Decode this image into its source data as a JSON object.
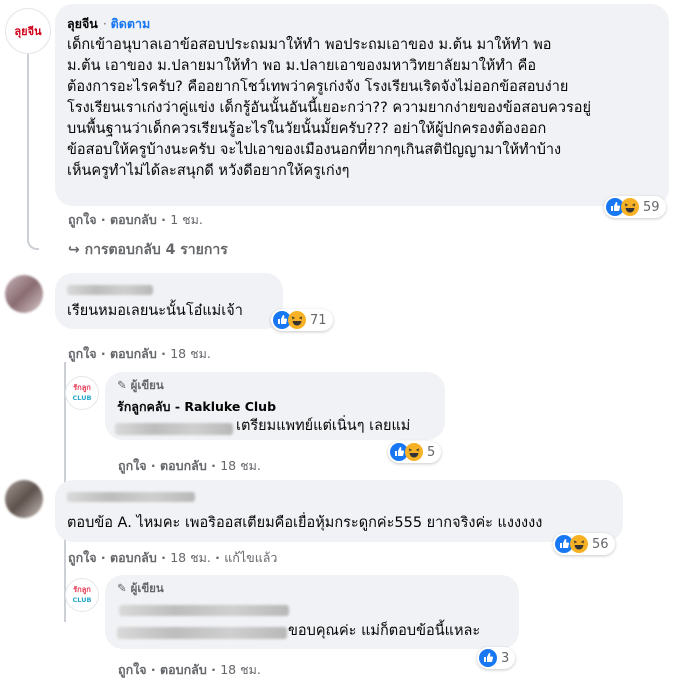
{
  "post_comment": {
    "author": "ลุยจีน",
    "follow_label": "ติดตาม",
    "text": "เด็กเข้าอนุบาลเอาข้อสอบประถมมาให้ทำ พอประถมเอาของ ม.ต้น มาให้ทำ พอ\nม.ต้น เอาของ ม.ปลายมาให้ทำ พอ ม.ปลายเอาของมหาวิทยาลัยมาให้ทำ คือ\nต้องการอะไรครับ? คืออยากโชว์เทพว่าครูเก่งจัง โรงเรียนเริดจังไม่ออกข้อสอบง่าย\nโรงเรียนเราเก่งว่าคู่แข่ง เด็กรู้อันนั้นอันนี้เยอะกว่า?? ความยากง่ายของข้อสอบควรอยู่\nบนพื้นฐานว่าเด็กควรเรียนรู้อะไรในวัยนั้นมั้ยครับ??? อย่าให้ผู้ปกครองต้องออก\nข้อสอบให้ครูบ้างนะครับ จะไปเอาของเมืองนอกที่ยากๆเกินสติปัญญามาให้ทำบ้าง\nเห็นครูทำไม่ได้ละสนุกดี หวังดีอยากให้ครูเก่งๆ",
    "like_label": "ถูกใจ",
    "reply_label": "ตอบกลับ",
    "time": "1 ชม.",
    "reactions_count": "59",
    "replies_link": "การตอบกลับ 4 รายการ",
    "avatar_text": "ลุยจีน"
  },
  "comment2": {
    "text": "เรียนหมอเลยนะนั้นโอ๋แม่เจ้า",
    "like_label": "ถูกใจ",
    "reply_label": "ตอบกลับ",
    "time": "18 ชม.",
    "reactions_count": "71"
  },
  "reply2": {
    "author_badge": "ผู้เขียน",
    "author": "รักลูกคลับ - Rakluke Club",
    "text": "เตรียมแพทย์แต่เนิ่นๆ เลยแม่",
    "like_label": "ถูกใจ",
    "reply_label": "ตอบกลับ",
    "time": "18 ชม.",
    "reactions_count": "5",
    "logo_top": "รักลูก",
    "logo_bottom": "CLUB"
  },
  "comment3": {
    "text": "ตอบข้อ A. ไหมคะ เพอริออสเตียมคือเยื่อหุ้มกระดูกค่ะ555 ยากจริงค่ะ แงงงงง",
    "like_label": "ถูกใจ",
    "reply_label": "ตอบกลับ",
    "time": "18 ชม.",
    "edited_label": "แก้ไขแล้ว",
    "reactions_count": "56"
  },
  "reply3": {
    "author_badge": "ผู้เขียน",
    "text": "ขอบคุณค่ะ แม่ก็ตอบข้อนี้แหละ",
    "like_label": "ถูกใจ",
    "reply_label": "ตอบกลับ",
    "time": "18 ชม.",
    "reactions_count": "3",
    "logo_top": "รักลูก",
    "logo_bottom": "CLUB"
  },
  "colors": {
    "facebook_blue": "#1877f2",
    "bubble_grey": "#f0f2f5",
    "meta_grey": "#65676b",
    "rakluke_red": "#e4405a",
    "rakluke_blue": "#27a6c9"
  },
  "icons": [
    "like-icon",
    "haha-icon",
    "reply-arrow-icon",
    "pencil-icon"
  ]
}
